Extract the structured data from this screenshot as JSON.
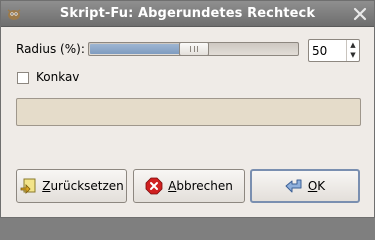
{
  "window": {
    "title": "Skript-Fu: Abgerundetes Rechteck",
    "app_icon": "gimp-icon",
    "close_icon": "close-icon"
  },
  "radius": {
    "label": "Radius (%):",
    "value": "50",
    "slider_fraction": 0.5
  },
  "concave": {
    "label": "Konkav",
    "checked": false
  },
  "buttons": {
    "reset": {
      "mnemonic": "Z",
      "rest": "urücksetzen",
      "icon": "reset-icon"
    },
    "cancel": {
      "mnemonic": "A",
      "rest": "bbrechen",
      "icon": "cancel-icon"
    },
    "ok": {
      "mnemonic": "O",
      "rest": "K",
      "icon": "ok-icon"
    }
  },
  "colors": {
    "title_bg": "#7d7d7d",
    "dialog_bg": "#efebe7",
    "progress_bg": "#e5dcca",
    "cancel_red": "#d02020",
    "ok_blue": "#5b7fb5"
  }
}
